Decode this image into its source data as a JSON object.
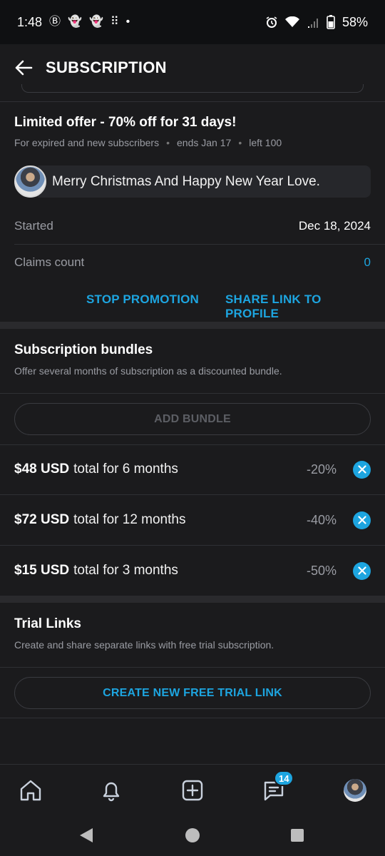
{
  "status_bar": {
    "time": "1:48",
    "notif_glyphs": [
      "Ⓑ",
      "👻",
      "👻",
      "⠿",
      "•"
    ],
    "battery": "58%"
  },
  "app_bar": {
    "title": "SUBSCRIPTION"
  },
  "promotion": {
    "title": "Limited offer - 70% off for 31 days!",
    "subtitle": "For expired and new subscribers",
    "ends": "ends Jan 17",
    "left": "left 100",
    "message": "Merry Christmas And Happy New Year Love.",
    "started_label": "Started",
    "started_value": "Dec 18, 2024",
    "claims_label": "Claims count",
    "claims_value": "0",
    "stop_label": "STOP PROMOTION",
    "share_label": "SHARE LINK TO PROFILE"
  },
  "bundles": {
    "title": "Subscription bundles",
    "subtitle": "Offer several months of subscription as a discounted bundle.",
    "add_label": "ADD BUNDLE",
    "items": [
      {
        "price": "$48 USD",
        "text": "total for 6 months",
        "discount": "-20%"
      },
      {
        "price": "$72 USD",
        "text": "total for 12 months",
        "discount": "-40%"
      },
      {
        "price": "$15 USD",
        "text": "total for 3 months",
        "discount": "-50%"
      }
    ]
  },
  "trial_links": {
    "title": "Trial Links",
    "subtitle": "Create and share separate links with free trial subscription.",
    "create_label": "CREATE NEW FREE TRIAL LINK"
  },
  "bottom_nav": {
    "items": [
      "home-icon",
      "bell-icon",
      "add-post-icon",
      "messages-icon",
      "profile-avatar"
    ],
    "messages_badge": "14"
  },
  "colors": {
    "accent": "#1da5e0",
    "background": "#1b1b1d",
    "muted_text": "#9a9ca3"
  }
}
